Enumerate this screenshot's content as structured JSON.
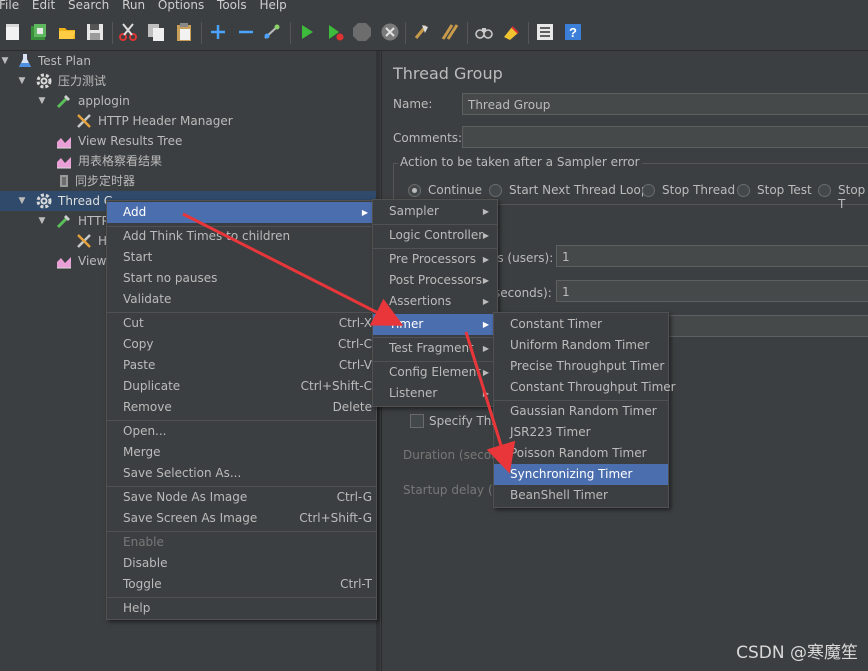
{
  "menubar": [
    "File",
    "Edit",
    "Search",
    "Run",
    "Options",
    "Tools",
    "Help"
  ],
  "tree": {
    "items": [
      {
        "label": "Test Plan",
        "icon": "flask-icon"
      },
      {
        "label": "压力测试",
        "icon": "gear-icon"
      },
      {
        "label": "applogin",
        "icon": "dropper-icon"
      },
      {
        "label": "HTTP Header Manager",
        "icon": "wrench-icon"
      },
      {
        "label": "View Results Tree",
        "icon": "graph-icon"
      },
      {
        "label": "用表格察看结果",
        "icon": "graph-icon"
      },
      {
        "label": "同步定时器",
        "icon": "timer-icon"
      },
      {
        "label": "Thread G",
        "icon": "gear-icon"
      },
      {
        "label": "HTTP",
        "icon": "dropper-icon"
      },
      {
        "label": "H",
        "icon": "wrench-icon"
      },
      {
        "label": "View",
        "icon": "graph-icon"
      }
    ]
  },
  "panel": {
    "title": "Thread Group",
    "name_label": "Name:",
    "name_value": "Thread Group",
    "comments_label": "Comments:",
    "error_action_label": "Action to be taken after a Sampler error",
    "radios": [
      "Continue",
      "Start Next Thread Loop",
      "Stop Thread",
      "Stop Test",
      "Stop T"
    ],
    "threads_label": "ls (users):",
    "threads_value": "1",
    "rampup_label": "seconds):",
    "rampup_value": "1",
    "specify_label": "Specify Thre",
    "duration_label": "Duration (second",
    "startup_label": "Startup delay (se"
  },
  "context_menu": {
    "items": [
      {
        "label": "Add",
        "submenu": true,
        "selected": true
      },
      {
        "sep": true
      },
      {
        "label": "Add Think Times to children"
      },
      {
        "label": "Start"
      },
      {
        "label": "Start no pauses"
      },
      {
        "label": "Validate"
      },
      {
        "sep": true
      },
      {
        "label": "Cut",
        "shortcut": "Ctrl-X"
      },
      {
        "label": "Copy",
        "shortcut": "Ctrl-C"
      },
      {
        "label": "Paste",
        "shortcut": "Ctrl-V"
      },
      {
        "label": "Duplicate",
        "shortcut": "Ctrl+Shift-C"
      },
      {
        "label": "Remove",
        "shortcut": "Delete"
      },
      {
        "sep": true
      },
      {
        "label": "Open..."
      },
      {
        "label": "Merge"
      },
      {
        "label": "Save Selection As..."
      },
      {
        "sep": true
      },
      {
        "label": "Save Node As Image",
        "shortcut": "Ctrl-G"
      },
      {
        "label": "Save Screen As Image",
        "shortcut": "Ctrl+Shift-G"
      },
      {
        "sep": true
      },
      {
        "label": "Enable",
        "disabled": true
      },
      {
        "label": "Disable"
      },
      {
        "label": "Toggle",
        "shortcut": "Ctrl-T"
      },
      {
        "sep": true
      },
      {
        "label": "Help"
      }
    ]
  },
  "add_menu": {
    "items": [
      {
        "label": "Sampler",
        "submenu": true
      },
      {
        "label": "Logic Controller",
        "submenu": true
      },
      {
        "label": "Pre Processors",
        "submenu": true
      },
      {
        "label": "Post Processors",
        "submenu": true
      },
      {
        "label": "Assertions",
        "submenu": true
      },
      {
        "label": "Timer",
        "submenu": true,
        "selected": true
      },
      {
        "label": "Test Fragment",
        "submenu": true
      },
      {
        "label": "Config Element",
        "submenu": true
      },
      {
        "label": "Listener",
        "submenu": true
      }
    ]
  },
  "timer_menu": {
    "items": [
      {
        "label": "Constant Timer"
      },
      {
        "label": "Uniform Random Timer"
      },
      {
        "label": "Precise Throughput Timer"
      },
      {
        "label": "Constant Throughput Timer"
      },
      {
        "label": "Gaussian Random Timer"
      },
      {
        "label": "JSR223 Timer"
      },
      {
        "label": "Poisson Random Timer"
      },
      {
        "label": "Synchronizing Timer",
        "selected": true
      },
      {
        "label": "BeanShell Timer"
      }
    ]
  },
  "watermark": "CSDN @寒魔笙",
  "colors": {
    "background": "#3c3f41",
    "selection": "#4b6eaf",
    "arrow": "#e8363a",
    "text": "#bbbbbb"
  }
}
